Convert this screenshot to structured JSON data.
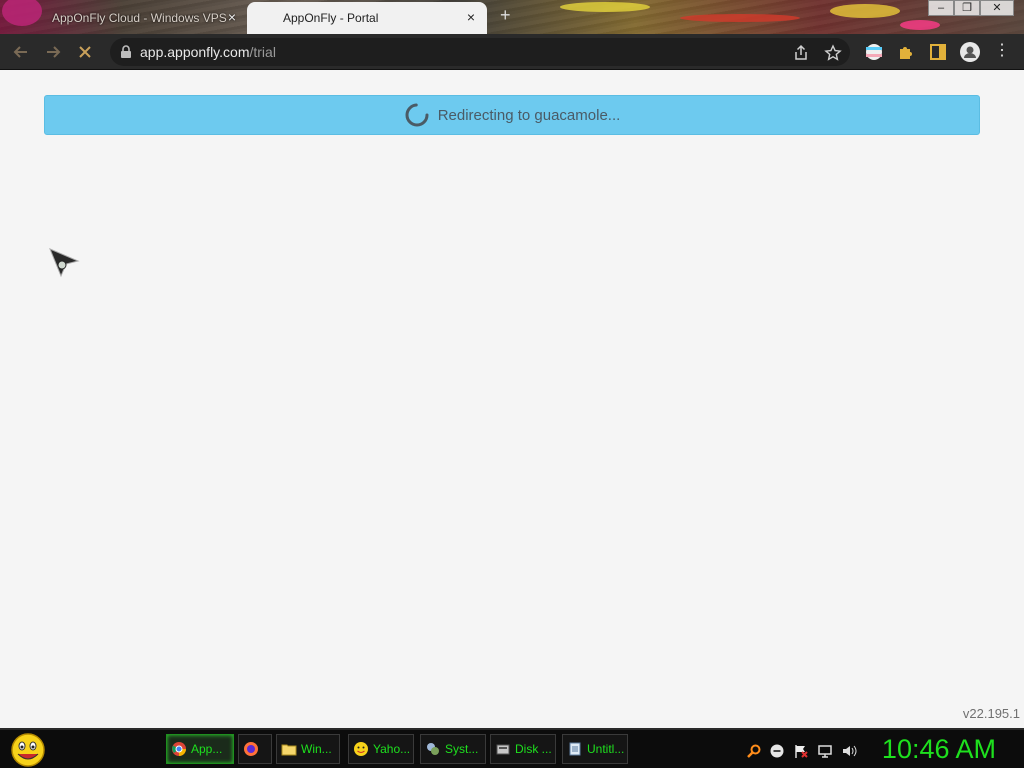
{
  "browser": {
    "tabs": [
      {
        "title": "AppOnFly Cloud - Windows VPS",
        "active": false
      },
      {
        "title": "AppOnFly - Portal",
        "active": true
      }
    ],
    "close_glyph": "×",
    "new_tab_glyph": "+",
    "window_controls": [
      "–",
      "❐",
      "✕"
    ],
    "url_host": "app.apponfly.com",
    "url_path": "/trial"
  },
  "page": {
    "alert_text": "Redirecting to guacamole...",
    "version": "v22.195.1"
  },
  "taskbar": {
    "items": [
      {
        "label": "App...",
        "icon": "chrome-icon",
        "active": true
      },
      {
        "label": "",
        "icon": "firefox-icon",
        "active": false
      },
      {
        "label": "Win...",
        "icon": "folder-icon",
        "active": false
      },
      {
        "label": "Yaho...",
        "icon": "yahoo-messenger-icon",
        "active": false
      },
      {
        "label": "Syst...",
        "icon": "system-icon",
        "active": false
      },
      {
        "label": "Disk ...",
        "icon": "disk-icon",
        "active": false
      },
      {
        "label": "Untitl...",
        "icon": "notepad-icon",
        "active": false
      }
    ],
    "clock": "10:46 AM"
  },
  "colors": {
    "alert_bg": "#6dcaef",
    "alert_text": "#4a5b66",
    "taskbar_text": "#1ee01e",
    "toolbar_bg": "#2a2a2a"
  }
}
